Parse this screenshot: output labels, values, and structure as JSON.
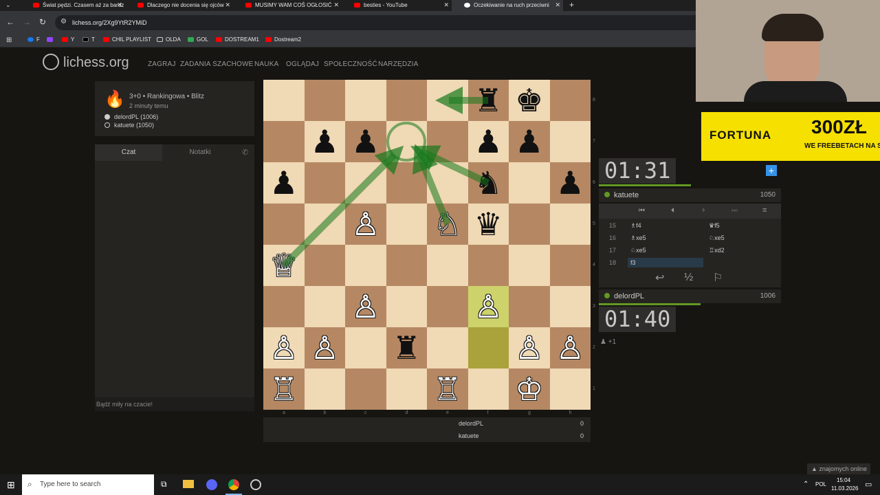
{
  "browser": {
    "tabs": [
      {
        "title": "Świat pędzi. Czasem aż za bardz"
      },
      {
        "title": "Dlaczego nie docenia się ojców"
      },
      {
        "title": "MUSIMY WAM COŚ OGŁOSIĆ"
      },
      {
        "title": "besties - YouTube"
      },
      {
        "title": "Oczekiwanie na ruch przeciwni"
      }
    ],
    "url": "lichess.org/2Xg9YtR2YMiD",
    "bookmarks": [
      "F",
      "Y",
      "T",
      "CHIL PLAYLIST",
      "OLDA",
      "GOL",
      "DOSTREAM1",
      "Dostream2"
    ]
  },
  "site": {
    "logo": "lichess.org",
    "nav": [
      "ZAGRAJ",
      "ZADANIA SZACHOWE",
      "NAUKA",
      "OGLĄDAJ",
      "SPOŁECZNOŚĆ",
      "NARZĘDZIA"
    ]
  },
  "game": {
    "mode": "3+0 • Rankingowa • Blitz",
    "time_ago": "2 minuty temu",
    "white_player": "delordPL (1006)",
    "black_player": "katuete (1050)"
  },
  "chat": {
    "tab_chat": "Czat",
    "tab_notes": "Notatki",
    "placeholder": "Bądź miły na czacie!"
  },
  "board": {
    "files": [
      "a",
      "b",
      "c",
      "d",
      "e",
      "f",
      "g",
      "h"
    ],
    "ranks": [
      "8",
      "7",
      "6",
      "5",
      "4",
      "3",
      "2",
      "1"
    ],
    "pieces": [
      {
        "sq": "f8",
        "p": "♜",
        "c": "b"
      },
      {
        "sq": "g8",
        "p": "♚",
        "c": "b"
      },
      {
        "sq": "b7",
        "p": "♟",
        "c": "b"
      },
      {
        "sq": "c7",
        "p": "♟",
        "c": "b"
      },
      {
        "sq": "f7",
        "p": "♟",
        "c": "b"
      },
      {
        "sq": "g7",
        "p": "♟",
        "c": "b"
      },
      {
        "sq": "a6",
        "p": "♟",
        "c": "b"
      },
      {
        "sq": "f6",
        "p": "♞",
        "c": "b"
      },
      {
        "sq": "h6",
        "p": "♟",
        "c": "b"
      },
      {
        "sq": "c5",
        "p": "♙",
        "c": "w"
      },
      {
        "sq": "e5",
        "p": "♘",
        "c": "w"
      },
      {
        "sq": "f5",
        "p": "♛",
        "c": "b"
      },
      {
        "sq": "a4",
        "p": "♕",
        "c": "w"
      },
      {
        "sq": "c3",
        "p": "♙",
        "c": "w"
      },
      {
        "sq": "f3",
        "p": "♙",
        "c": "w"
      },
      {
        "sq": "a2",
        "p": "♙",
        "c": "w"
      },
      {
        "sq": "b2",
        "p": "♙",
        "c": "w"
      },
      {
        "sq": "d2",
        "p": "♜",
        "c": "b"
      },
      {
        "sq": "g2",
        "p": "♙",
        "c": "w"
      },
      {
        "sq": "h2",
        "p": "♙",
        "c": "w"
      },
      {
        "sq": "a1",
        "p": "♖",
        "c": "w"
      },
      {
        "sq": "e1",
        "p": "♖",
        "c": "w"
      },
      {
        "sq": "g1",
        "p": "♔",
        "c": "w"
      }
    ],
    "last_move": [
      "f2",
      "f3"
    ],
    "colors": {
      "light": "#f0d9b5",
      "dark": "#b58863",
      "highlight_light": "#cdd26a",
      "highlight_dark": "#aaa23a",
      "arrow": "#15781b"
    }
  },
  "clocks": {
    "top_time": "01:31",
    "top_player": "katuete",
    "top_rating": "1050",
    "bottom_time": "01:40",
    "bottom_player": "delordPL",
    "bottom_rating": "1006"
  },
  "moves": [
    {
      "n": "15",
      "w": "♗f4",
      "b": "♛f5"
    },
    {
      "n": "16",
      "w": "♗xe5",
      "b": "♘xe5"
    },
    {
      "n": "17",
      "w": "♘xe5",
      "b": "♖xd2"
    },
    {
      "n": "18",
      "w": "f3",
      "b": ""
    }
  ],
  "score": {
    "p1": "delordPL",
    "p1_score": "0",
    "p2": "katuete",
    "p2_score": "0"
  },
  "ad": {
    "brand": "FORTUNA",
    "amount": "300ZŁ",
    "tagline": "WE FREEBETACH NA STAR"
  },
  "footer": {
    "friends": "znajomych online",
    "search": "Type here to search",
    "lang": "POL",
    "time": "15:04",
    "date": "11.03.2026"
  }
}
